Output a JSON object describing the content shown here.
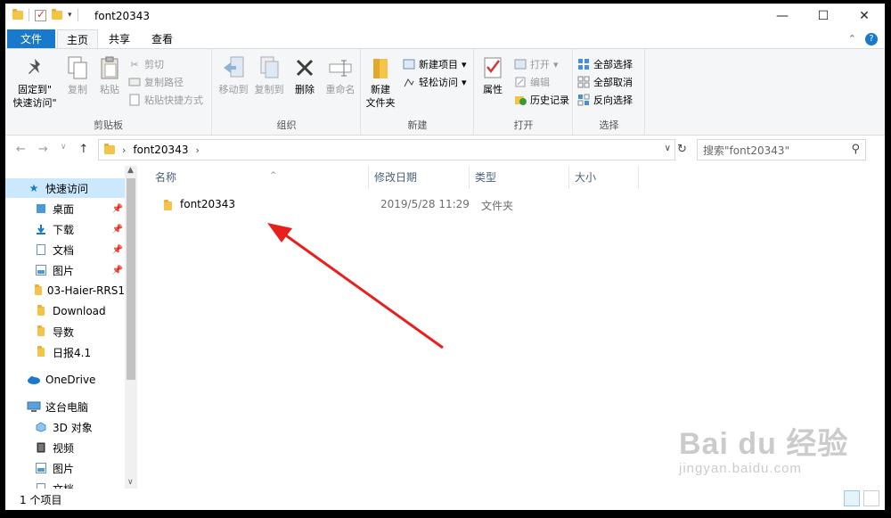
{
  "window": {
    "title": "font20343",
    "controls": {
      "minimize": "—",
      "maximize": "☐",
      "close": "✕"
    }
  },
  "tabs": {
    "file": "文件",
    "home": "主页",
    "share": "共享",
    "view": "查看"
  },
  "ribbon": {
    "clipboard": {
      "label": "剪贴板",
      "pin_line1": "固定到\"",
      "pin_line2": "快速访问\"",
      "copy": "复制",
      "paste": "粘贴",
      "cut": "剪切",
      "copy_path": "复制路径",
      "paste_shortcut": "粘贴快捷方式"
    },
    "organize": {
      "label": "组织",
      "move_to": "移动到",
      "copy_to": "复制到",
      "delete": "删除",
      "rename": "重命名"
    },
    "new": {
      "label": "新建",
      "new_folder_line1": "新建",
      "new_folder_line2": "文件夹",
      "new_item": "新建项目",
      "easy_access": "轻松访问"
    },
    "open": {
      "label": "打开",
      "properties": "属性",
      "open": "打开",
      "edit": "编辑",
      "history": "历史记录"
    },
    "select": {
      "label": "选择",
      "select_all": "全部选择",
      "select_none": "全部取消",
      "invert": "反向选择"
    }
  },
  "address": {
    "crumb": "font20343",
    "search_placeholder": "搜索\"font20343\""
  },
  "navpane": {
    "quick_access": "快速访问",
    "items": [
      "桌面",
      "下载",
      "文档",
      "图片",
      "03-Haier-RRS1",
      "Download",
      "导数",
      "日报4.1"
    ],
    "onedrive": "OneDrive",
    "this_pc": "这台电脑",
    "pc_items": [
      "3D 对象",
      "视频",
      "图片",
      "文档"
    ]
  },
  "columns": {
    "name": "名称",
    "modified": "修改日期",
    "type": "类型",
    "size": "大小"
  },
  "files": [
    {
      "name": "font20343",
      "modified": "2019/5/28 11:29",
      "type": "文件夹",
      "size": ""
    }
  ],
  "status": {
    "count": "1 个项目"
  },
  "watermark": {
    "brand": "Bai du 经验",
    "url": "jingyan.baidu.com"
  },
  "colors": {
    "accent": "#1979ca",
    "selected": "#cce8ff",
    "arrow": "#e8201c",
    "folder": "#f3c34a"
  }
}
